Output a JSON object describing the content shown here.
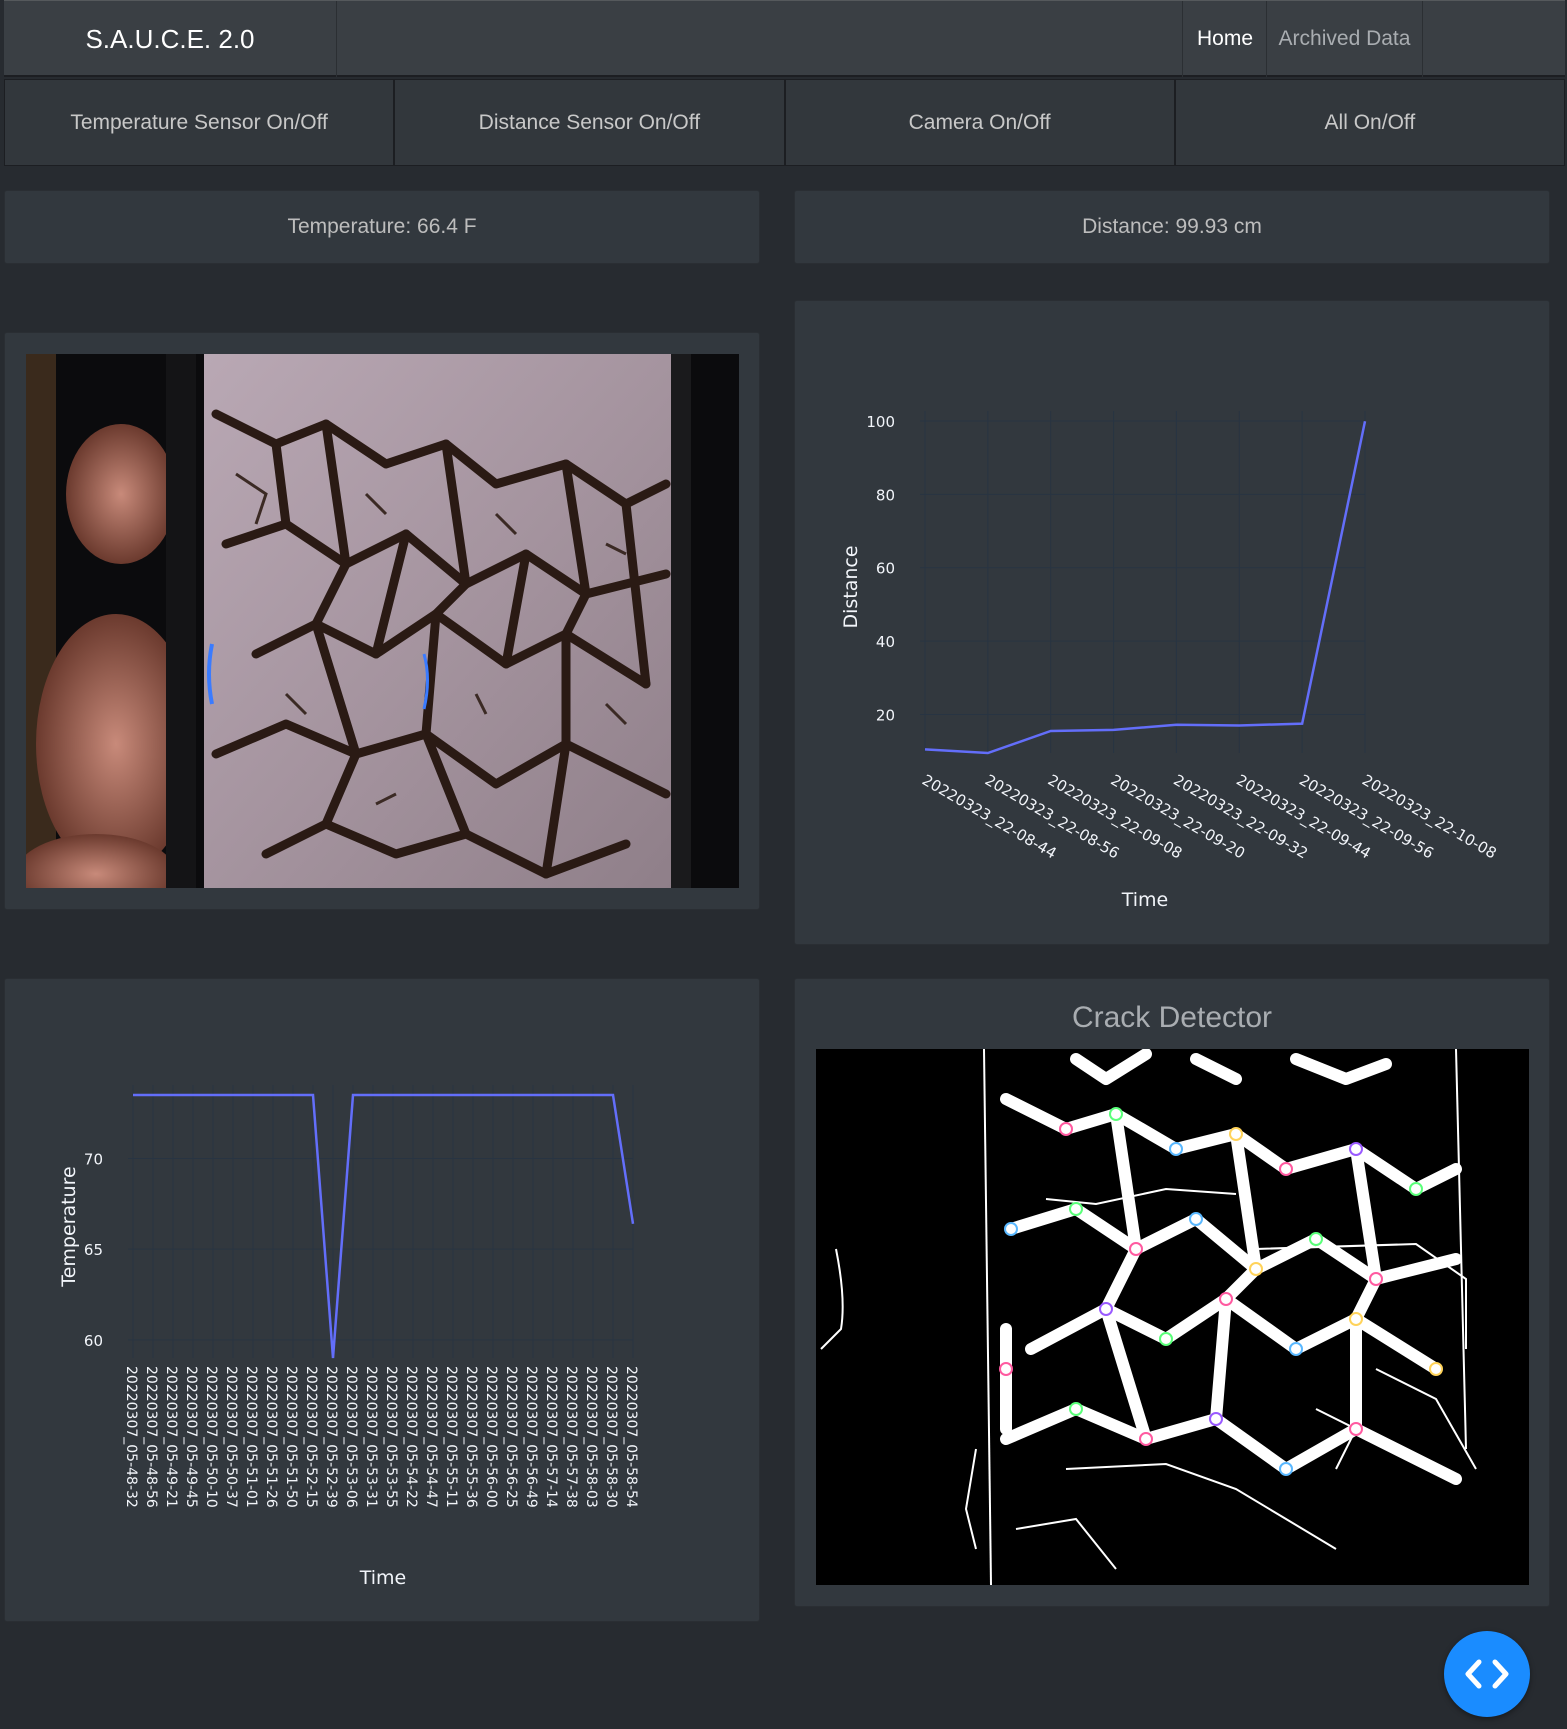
{
  "brand": "S.A.U.C.E. 2.0",
  "nav": {
    "home": "Home",
    "archived": "Archived Data"
  },
  "toggles": {
    "temperature": "Temperature Sensor On/Off",
    "distance": "Distance Sensor On/Off",
    "camera": "Camera On/Off",
    "all": "All On/Off"
  },
  "readouts": {
    "temperature": "Temperature: 66.4 F",
    "distance": "Distance: 99.93 cm"
  },
  "crack_detector": {
    "title": "Crack Detector"
  },
  "fab_icon": "code-icon",
  "colors": {
    "accent": "#1a8cff",
    "line": "#636efa"
  },
  "chart_data": [
    {
      "type": "line",
      "name": "distance-chart",
      "xlabel": "Time",
      "ylabel": "Distance",
      "categories": [
        "20220323_22-08-44",
        "20220323_22-08-56",
        "20220323_22-09-08",
        "20220323_22-09-20",
        "20220323_22-09-32",
        "20220323_22-09-44",
        "20220323_22-09-56",
        "20220323_22-10-08"
      ],
      "values": [
        10.5,
        9.5,
        15.5,
        15.8,
        17.2,
        17.0,
        17.5,
        99.93
      ],
      "yticks": [
        20,
        40,
        60,
        80,
        100
      ],
      "ylim": [
        9.5,
        100
      ]
    },
    {
      "type": "line",
      "name": "temperature-chart",
      "xlabel": "Time",
      "ylabel": "Temperature",
      "categories": [
        "20220307_05-48-32",
        "20220307_05-48-56",
        "20220307_05-49-21",
        "20220307_05-49-45",
        "20220307_05-50-10",
        "20220307_05-50-37",
        "20220307_05-51-01",
        "20220307_05-51-26",
        "20220307_05-51-50",
        "20220307_05-52-15",
        "20220307_05-52-39",
        "20220307_05-53-06",
        "20220307_05-53-31",
        "20220307_05-53-55",
        "20220307_05-54-22",
        "20220307_05-54-47",
        "20220307_05-55-11",
        "20220307_05-55-36",
        "20220307_05-56-00",
        "20220307_05-56-25",
        "20220307_05-56-49",
        "20220307_05-57-14",
        "20220307_05-57-38",
        "20220307_05-58-03",
        "20220307_05-58-30",
        "20220307_05-58-54"
      ],
      "values": [
        73.5,
        73.5,
        73.5,
        73.5,
        73.5,
        73.5,
        73.5,
        73.5,
        73.5,
        73.5,
        59.0,
        73.5,
        73.5,
        73.5,
        73.5,
        73.5,
        73.5,
        73.5,
        73.5,
        73.5,
        73.5,
        73.5,
        73.5,
        73.5,
        73.5,
        66.4
      ],
      "yticks": [
        60,
        65,
        70
      ],
      "ylim": [
        59,
        73.5
      ]
    }
  ]
}
